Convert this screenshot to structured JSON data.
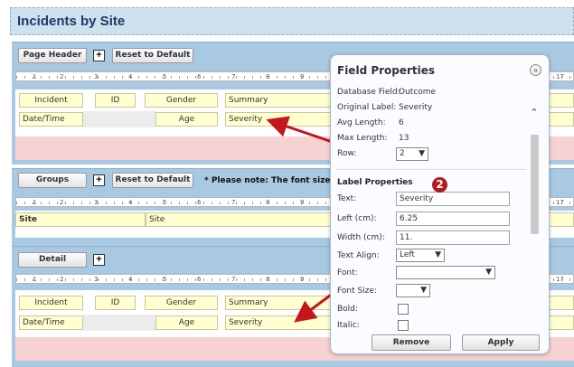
{
  "title": "Incidents by Site",
  "page_header": {
    "button_label": "Page Header",
    "reset_label": "Reset to Default",
    "expand_glyph": "+"
  },
  "ruler": {
    "labels": [
      "1",
      "2",
      "3",
      "4",
      "5",
      "6",
      "7",
      "8",
      "9",
      "17"
    ]
  },
  "header_fields": {
    "row1": [
      "Incident",
      "ID",
      "Gender",
      "Summary"
    ],
    "row2": [
      "Date/Time",
      "Age",
      "Severity"
    ]
  },
  "groups": {
    "button_label": "Groups",
    "reset_label": "Reset to Default",
    "expand_glyph": "+",
    "note": "* Please note: The font sizes fo",
    "row": [
      "Site",
      "Site"
    ]
  },
  "detail": {
    "button_label": "Detail",
    "expand_glyph": "+",
    "row1": [
      "Incident",
      "ID",
      "Gender",
      "Summary"
    ],
    "row2": [
      "Date/Time",
      "Age",
      "Severity"
    ]
  },
  "panel": {
    "title": "Field Properties",
    "collapse_glyph": "»",
    "database_field_label": "Database Field:",
    "database_field_value": "Outcome",
    "original_label_label": "Original Label:",
    "original_label_value": "Severity",
    "avg_length_label": "Avg Length:",
    "avg_length_value": "6",
    "max_length_label": "Max Length:",
    "max_length_value": "13",
    "row_label": "Row:",
    "row_value": "2",
    "label_properties_heading": "Label Properties",
    "text_label": "Text:",
    "text_value": "Severity",
    "left_label": "Left (cm):",
    "left_value": "6.25",
    "width_label": "Width (cm):",
    "width_value": "11.",
    "text_align_label": "Text Align:",
    "text_align_value": "Left",
    "font_label": "Font:",
    "font_value": "",
    "font_size_label": "Font Size:",
    "font_size_value": "",
    "bold_label": "Bold:",
    "italic_label": "Italic:",
    "remove_label": "Remove",
    "apply_label": "Apply"
  },
  "annotation": {
    "badge": "2",
    "color": "#b4191b"
  },
  "colors": {
    "section_bg": "#a9c8e2",
    "field_bg": "#ffffd0",
    "pink_band": "#f6d2d2"
  }
}
